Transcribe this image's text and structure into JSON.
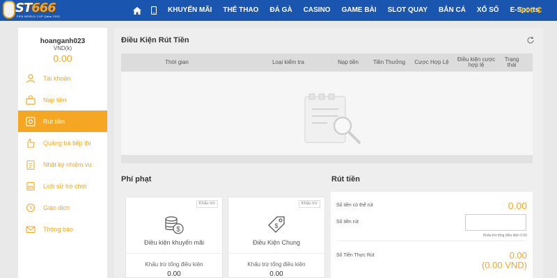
{
  "header": {
    "logo_text_main": "ST",
    "logo_text_accent": "666",
    "logo_sub": "FIFA WORLD CUP Qatar 2022",
    "nav": [
      "KHUYẾN MÃI",
      "THỂ THAO",
      "ĐÁ GÀ",
      "CASINO",
      "GAME BÀI",
      "SLOT QUAY",
      "BẮN CÁ",
      "XỔ SỐ",
      "E-Sports"
    ],
    "balance": "0.00 ₵"
  },
  "sidebar": {
    "username": "hoanganh023",
    "currency": "VND(k)",
    "balance": "0.00",
    "items": [
      {
        "label": "Tài khoản",
        "icon": "user-icon"
      },
      {
        "label": "Nạp tiền",
        "icon": "deposit-icon"
      },
      {
        "label": "Rút tiền",
        "icon": "withdraw-icon"
      },
      {
        "label": "Quảng bá tiếp thị",
        "icon": "promo-icon"
      },
      {
        "label": "Nhật ký nhiệm vụ",
        "icon": "task-icon"
      },
      {
        "label": "Lịch sử trò chơi",
        "icon": "history-icon"
      },
      {
        "label": "Giao dịch",
        "icon": "transaction-icon"
      },
      {
        "label": "Thông báo",
        "icon": "mail-icon"
      }
    ],
    "active_index": 2
  },
  "conditions": {
    "title": "Điều Kiện Rút Tiền",
    "columns": [
      "Thời gian",
      "Loại kiểm tra",
      "Nạp tiền",
      "Tiền Thưởng",
      "Cược Hợp Lệ",
      "Điều kiện cược hợp lệ",
      "Trạng thái"
    ]
  },
  "penalty": {
    "title": "Phí phạt",
    "cards": [
      {
        "tag": "Khấu trừ",
        "title": "Điều kiện khuyến mãi",
        "sub": "Khấu trừ tổng điều kiện",
        "value": "0.00"
      },
      {
        "tag": "Khấu trừ",
        "title": "Điều Kiện Chung",
        "sub": "Khấu trừ tổng điều kiện",
        "value": "0.00"
      }
    ]
  },
  "withdraw": {
    "title": "Rút tiền",
    "available_label": "Số tiền có thể rút",
    "available_value": "0.00",
    "amount_label": "Số tiền rút",
    "amount_placeholder": "",
    "note": "Khấu trừ tổng điều kiện 0.00",
    "actual_label": "Số Tiền Thực Rút",
    "actual_value": "0.00",
    "actual_vnd": "(0.00 VND)"
  },
  "colors": {
    "nav": "#1a56b0",
    "accent": "#f5a623"
  }
}
